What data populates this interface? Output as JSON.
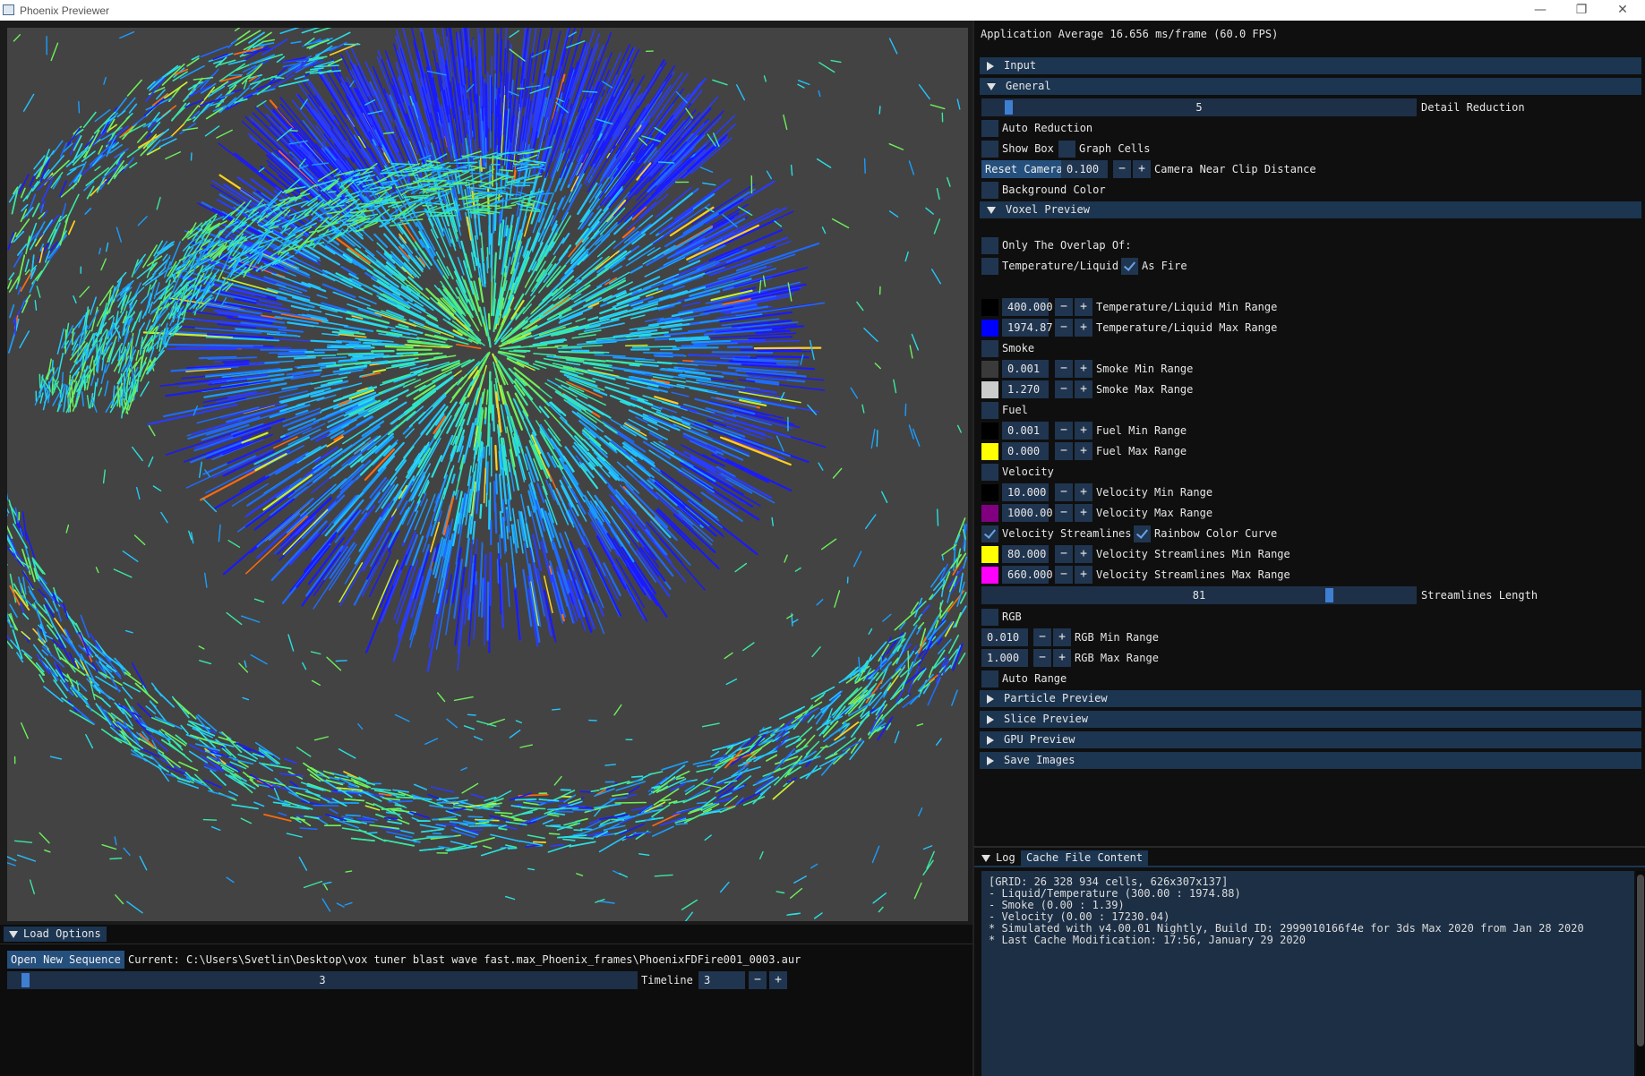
{
  "window": {
    "title": "Phoenix Previewer",
    "minimize_glyph": "—",
    "restore_glyph": "❐",
    "close_glyph": "✕"
  },
  "viewport": {
    "background_color": "#434343"
  },
  "load_options": {
    "tab_label": "Load Options",
    "open_button": "Open New Sequence",
    "current_path": "Current: C:\\Users\\Svetlin\\Desktop\\vox tuner blast wave fast.max_Phoenix_frames\\PhoenixFDFire001_0003.aur",
    "timeline_slider_value": "3",
    "timeline_slider_fraction": 0.02,
    "timeline_label": "Timeline",
    "timeline_input": "3",
    "minus": "−",
    "plus": "+"
  },
  "stats": {
    "fps_text": "Application Average 16.656 ms/frame (60.0 FPS)"
  },
  "sections": {
    "input": "Input",
    "general": "General",
    "voxel_preview": "Voxel Preview",
    "particle_preview": "Particle Preview",
    "slice_preview": "Slice Preview",
    "gpu_preview": "GPU Preview",
    "save_images": "Save Images"
  },
  "general": {
    "detail_reduction_value": "5",
    "detail_reduction_fraction": 0.05,
    "detail_reduction_label": "Detail Reduction",
    "auto_reduction": "Auto Reduction",
    "show_box": "Show Box",
    "graph_cells": "Graph Cells",
    "reset_camera": "Reset Camera",
    "near_clip_value": "0.100",
    "near_clip_label": "Camera Near Clip Distance",
    "background_color": "Background Color"
  },
  "voxel": {
    "only_overlap": "Only The Overlap Of:",
    "temperature_liquid": "Temperature/Liquid",
    "as_fire": "As Fire",
    "temp_min_value": "400.000",
    "temp_min_label": "Temperature/Liquid Min Range",
    "temp_max_value": "1974.87",
    "temp_max_label": "Temperature/Liquid Max Range",
    "smoke": "Smoke",
    "smoke_min_value": "0.001",
    "smoke_min_label": "Smoke Min Range",
    "smoke_max_value": "1.270",
    "smoke_max_label": "Smoke Max Range",
    "fuel": "Fuel",
    "fuel_min_value": "0.001",
    "fuel_min_label": "Fuel Min Range",
    "fuel_max_value": "0.000",
    "fuel_max_label": "Fuel Max Range",
    "velocity": "Velocity",
    "vel_min_value": "10.000",
    "vel_min_label": "Velocity Min Range",
    "vel_max_value": "1000.00",
    "vel_max_label": "Velocity Max Range",
    "velocity_streamlines": "Velocity Streamlines",
    "rainbow_color_curve": "Rainbow Color Curve",
    "vs_min_value": "80.000",
    "vs_min_label": "Velocity Streamlines Min Range",
    "vs_max_value": "660.000",
    "vs_max_label": "Velocity Streamlines Max Range",
    "streamlines_length_value": "81",
    "streamlines_length_fraction": 0.8,
    "streamlines_length_label": "Streamlines Length",
    "rgb": "RGB",
    "rgb_min_value": "0.010",
    "rgb_min_label": "RGB Min Range",
    "rgb_max_value": "1.000",
    "rgb_max_label": "RGB Max Range",
    "auto_range": "Auto Range",
    "swatch_colors": {
      "temp_min": "#000000",
      "temp_max": "#0000ff",
      "smoke_min": "#3a3a3a",
      "smoke_max": "#cccccc",
      "fuel_min": "#000000",
      "fuel_max": "#ffff00",
      "vel_min": "#000000",
      "vel_max": "#800080",
      "vs_min": "#ffff00",
      "vs_max": "#ff00ff"
    }
  },
  "log": {
    "tab_log": "Log",
    "tab_cache": "Cache File Content",
    "lines": [
      "[GRID: 26 328 934 cells, 626x307x137]",
      "- Liquid/Temperature (300.00 : 1974.88)",
      "- Smoke (0.00 : 1.39)",
      "- Velocity (0.00 : 17230.04)",
      "* Simulated with v4.00.01 Nightly, Build ID: 2999010166f4e for 3ds Max 2020 from Jan 28 2020",
      "* Last Cache Modification: 17:56, January 29 2020"
    ]
  }
}
